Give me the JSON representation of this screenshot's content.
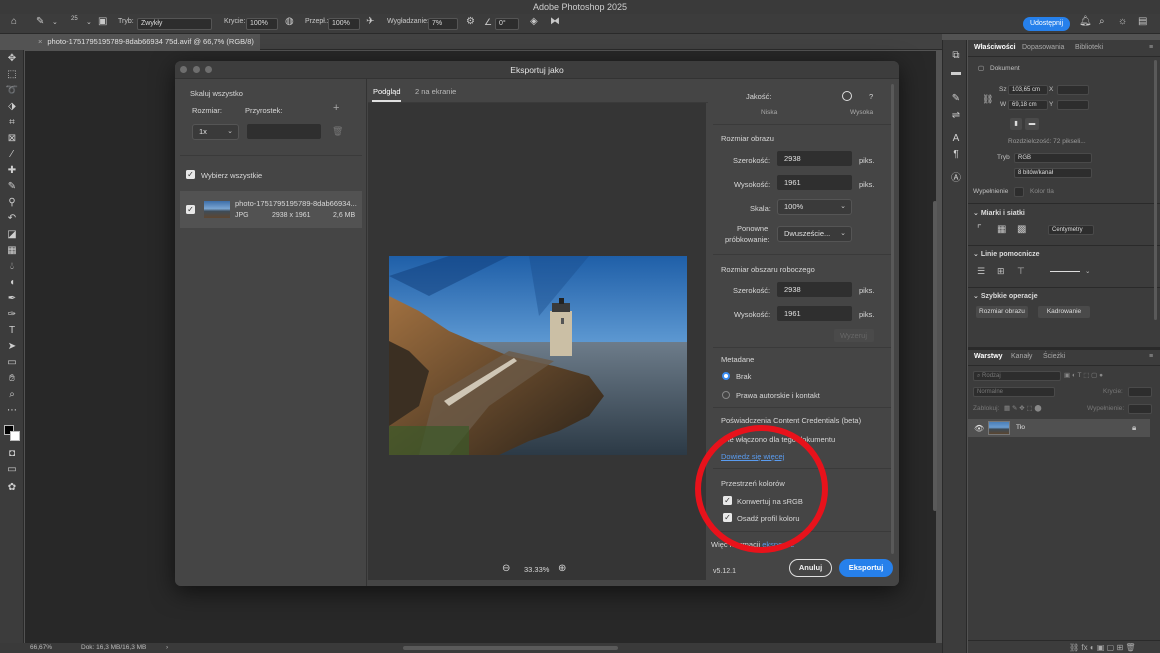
{
  "app": {
    "title": "Adobe Photoshop 2025"
  },
  "options_bar": {
    "brush_size": "25",
    "mode_label": "Tryb:",
    "mode_value": "Zwykły",
    "opacity_label": "Krycie:",
    "opacity_value": "100%",
    "flow_label": "Przepł.:",
    "flow_value": "100%",
    "smoothing_label": "Wygładzanie:",
    "smoothing_value": "7%",
    "angle_value": "0°",
    "share_label": "Udostępnij"
  },
  "document_tab": {
    "label": "photo-1751795195789-8dab66934 75d.avif @ 66,7% (RGB/8)"
  },
  "status_bar": {
    "zoom": "66,67%",
    "doc_info": "Dok: 16,3 MB/16,3 MB"
  },
  "dialog": {
    "title": "Eksportuj jako",
    "left": {
      "scale_all_label": "Skaluj wszystko",
      "size_label": "Rozmiar:",
      "suffix_label": "Przyrostek:",
      "size_value": "1x",
      "suffix_value": "",
      "select_all_label": "Wybierz wszystkie",
      "file": {
        "name": "photo-1751795195789-8dab66934...",
        "format": "JPG",
        "dimensions": "2938 x 1961",
        "filesize": "2,6 MB"
      }
    },
    "preview": {
      "tabs": [
        "Podgląd",
        "2 na ekranie"
      ],
      "zoom": "33.33%"
    },
    "right": {
      "quality_label": "Jakość:",
      "quality_low": "Niska",
      "quality_high": "Wysoka",
      "help": "?",
      "image_size_header": "Rozmiar obrazu",
      "width_label": "Szerokość:",
      "width_value": "2938",
      "height_label": "Wysokość:",
      "height_value": "1961",
      "unit": "piks.",
      "scale_label": "Skala:",
      "scale_value": "100%",
      "resample_label_1": "Ponowne",
      "resample_label_2": "próbkowanie:",
      "resample_value": "Dwuszeście...",
      "canvas_size_header": "Rozmiar obszaru roboczego",
      "canvas_width_value": "2938",
      "canvas_height_value": "1961",
      "reset_label": "Wyzeruj",
      "metadata_header": "Metadane",
      "metadata_none": "Brak",
      "metadata_copyright": "Prawa autorskie i kontakt",
      "credentials_header": "Poświadczenia Content Credentials (beta)",
      "credentials_status": "ie włączono dla tego dokumentu",
      "learn_more": "Dowiedz się więcej",
      "color_space_header": "Przestrzeń kolorów",
      "convert_srgb": "Konwertuj na sRGB",
      "embed_profile": "Osadź profil koloru",
      "more_info_prefix": "Więc   nformacji ",
      "more_info_link": "  eksporcie",
      "version": "v5.12.1",
      "cancel_label": "Anuluj",
      "export_label": "Eksportuj"
    }
  },
  "properties_panel": {
    "tabs": [
      "Właściwości",
      "Dopasowania",
      "Biblioteki"
    ],
    "doc_label": "Dokument",
    "w_label": "Sz",
    "w_value": "103,65 cm",
    "h_label": "W",
    "h_value": "69,18 cm",
    "x_label": "X",
    "y_label": "Y",
    "resolution": "Rozdzielczość: 72 pikseli...",
    "mode_label": "Tryb",
    "mode_value": "RGB",
    "bits_value": "8 bitów/kanał",
    "fill_label": "Wypełnienie",
    "fill_color": "Kolor tła",
    "rulers_header": "Miarki i siatki",
    "units_value": "Centymetry",
    "guides_header": "Linie pomocnicze",
    "quick_actions_header": "Szybkie operacje",
    "resize_btn": "Rozmiar obrazu",
    "crop_btn": "Kadrowanie"
  },
  "layers_panel": {
    "tabs": [
      "Warstwy",
      "Kanały",
      "Ścieżki"
    ],
    "search_placeholder": "Rodzaj",
    "blend_mode": "Normalne",
    "opacity_label": "Krycie:",
    "lock_label": "Zablokuj:",
    "fill_label": "Wypełnienie:",
    "layer_name": "Tło"
  },
  "colors": {
    "accent": "#2680eb",
    "annotation": "#e8121b"
  }
}
